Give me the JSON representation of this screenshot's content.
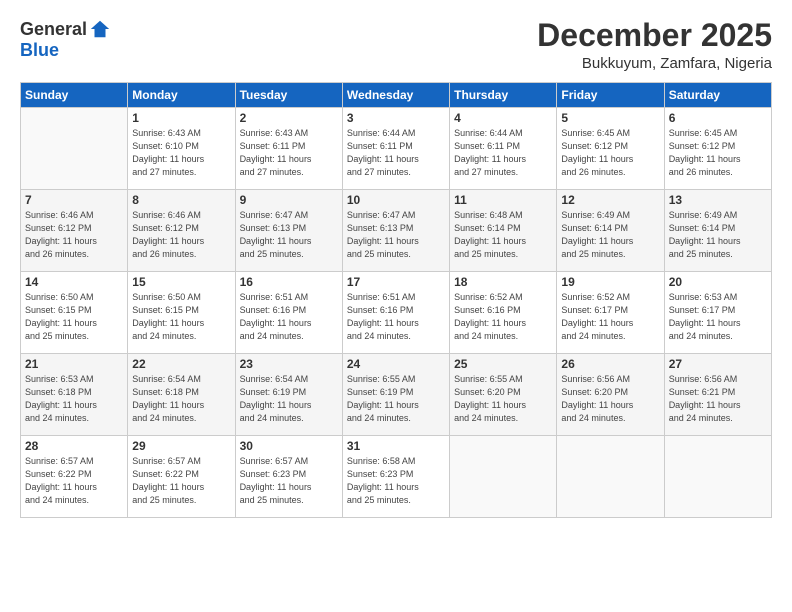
{
  "logo": {
    "general": "General",
    "blue": "Blue"
  },
  "header": {
    "month": "December 2025",
    "location": "Bukkuyum, Zamfara, Nigeria"
  },
  "weekdays": [
    "Sunday",
    "Monday",
    "Tuesday",
    "Wednesday",
    "Thursday",
    "Friday",
    "Saturday"
  ],
  "weeks": [
    [
      {
        "day": "",
        "info": ""
      },
      {
        "day": "1",
        "info": "Sunrise: 6:43 AM\nSunset: 6:10 PM\nDaylight: 11 hours\nand 27 minutes."
      },
      {
        "day": "2",
        "info": "Sunrise: 6:43 AM\nSunset: 6:11 PM\nDaylight: 11 hours\nand 27 minutes."
      },
      {
        "day": "3",
        "info": "Sunrise: 6:44 AM\nSunset: 6:11 PM\nDaylight: 11 hours\nand 27 minutes."
      },
      {
        "day": "4",
        "info": "Sunrise: 6:44 AM\nSunset: 6:11 PM\nDaylight: 11 hours\nand 27 minutes."
      },
      {
        "day": "5",
        "info": "Sunrise: 6:45 AM\nSunset: 6:12 PM\nDaylight: 11 hours\nand 26 minutes."
      },
      {
        "day": "6",
        "info": "Sunrise: 6:45 AM\nSunset: 6:12 PM\nDaylight: 11 hours\nand 26 minutes."
      }
    ],
    [
      {
        "day": "7",
        "info": "Sunrise: 6:46 AM\nSunset: 6:12 PM\nDaylight: 11 hours\nand 26 minutes."
      },
      {
        "day": "8",
        "info": "Sunrise: 6:46 AM\nSunset: 6:12 PM\nDaylight: 11 hours\nand 26 minutes."
      },
      {
        "day": "9",
        "info": "Sunrise: 6:47 AM\nSunset: 6:13 PM\nDaylight: 11 hours\nand 25 minutes."
      },
      {
        "day": "10",
        "info": "Sunrise: 6:47 AM\nSunset: 6:13 PM\nDaylight: 11 hours\nand 25 minutes."
      },
      {
        "day": "11",
        "info": "Sunrise: 6:48 AM\nSunset: 6:14 PM\nDaylight: 11 hours\nand 25 minutes."
      },
      {
        "day": "12",
        "info": "Sunrise: 6:49 AM\nSunset: 6:14 PM\nDaylight: 11 hours\nand 25 minutes."
      },
      {
        "day": "13",
        "info": "Sunrise: 6:49 AM\nSunset: 6:14 PM\nDaylight: 11 hours\nand 25 minutes."
      }
    ],
    [
      {
        "day": "14",
        "info": "Sunrise: 6:50 AM\nSunset: 6:15 PM\nDaylight: 11 hours\nand 25 minutes."
      },
      {
        "day": "15",
        "info": "Sunrise: 6:50 AM\nSunset: 6:15 PM\nDaylight: 11 hours\nand 24 minutes."
      },
      {
        "day": "16",
        "info": "Sunrise: 6:51 AM\nSunset: 6:16 PM\nDaylight: 11 hours\nand 24 minutes."
      },
      {
        "day": "17",
        "info": "Sunrise: 6:51 AM\nSunset: 6:16 PM\nDaylight: 11 hours\nand 24 minutes."
      },
      {
        "day": "18",
        "info": "Sunrise: 6:52 AM\nSunset: 6:16 PM\nDaylight: 11 hours\nand 24 minutes."
      },
      {
        "day": "19",
        "info": "Sunrise: 6:52 AM\nSunset: 6:17 PM\nDaylight: 11 hours\nand 24 minutes."
      },
      {
        "day": "20",
        "info": "Sunrise: 6:53 AM\nSunset: 6:17 PM\nDaylight: 11 hours\nand 24 minutes."
      }
    ],
    [
      {
        "day": "21",
        "info": "Sunrise: 6:53 AM\nSunset: 6:18 PM\nDaylight: 11 hours\nand 24 minutes."
      },
      {
        "day": "22",
        "info": "Sunrise: 6:54 AM\nSunset: 6:18 PM\nDaylight: 11 hours\nand 24 minutes."
      },
      {
        "day": "23",
        "info": "Sunrise: 6:54 AM\nSunset: 6:19 PM\nDaylight: 11 hours\nand 24 minutes."
      },
      {
        "day": "24",
        "info": "Sunrise: 6:55 AM\nSunset: 6:19 PM\nDaylight: 11 hours\nand 24 minutes."
      },
      {
        "day": "25",
        "info": "Sunrise: 6:55 AM\nSunset: 6:20 PM\nDaylight: 11 hours\nand 24 minutes."
      },
      {
        "day": "26",
        "info": "Sunrise: 6:56 AM\nSunset: 6:20 PM\nDaylight: 11 hours\nand 24 minutes."
      },
      {
        "day": "27",
        "info": "Sunrise: 6:56 AM\nSunset: 6:21 PM\nDaylight: 11 hours\nand 24 minutes."
      }
    ],
    [
      {
        "day": "28",
        "info": "Sunrise: 6:57 AM\nSunset: 6:22 PM\nDaylight: 11 hours\nand 24 minutes."
      },
      {
        "day": "29",
        "info": "Sunrise: 6:57 AM\nSunset: 6:22 PM\nDaylight: 11 hours\nand 25 minutes."
      },
      {
        "day": "30",
        "info": "Sunrise: 6:57 AM\nSunset: 6:23 PM\nDaylight: 11 hours\nand 25 minutes."
      },
      {
        "day": "31",
        "info": "Sunrise: 6:58 AM\nSunset: 6:23 PM\nDaylight: 11 hours\nand 25 minutes."
      },
      {
        "day": "",
        "info": ""
      },
      {
        "day": "",
        "info": ""
      },
      {
        "day": "",
        "info": ""
      }
    ]
  ]
}
